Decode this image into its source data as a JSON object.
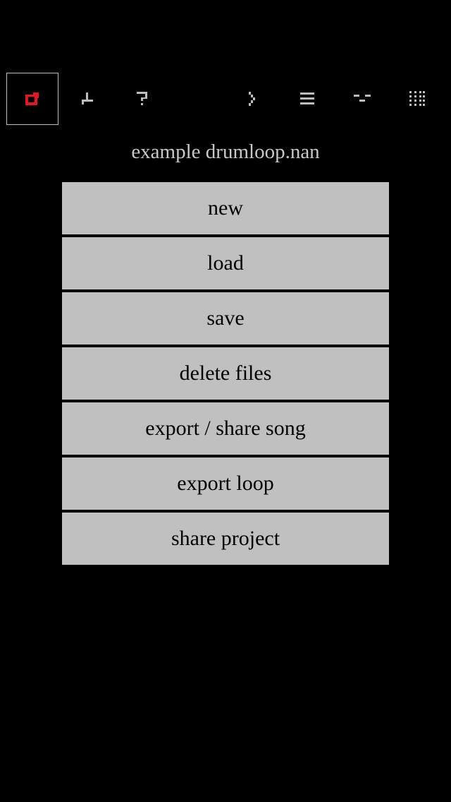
{
  "toolbar": {
    "tools": [
      {
        "icon": "file-menu-icon",
        "color": "#e8141e",
        "active": true
      },
      {
        "icon": "sample-edit-icon",
        "color": "#bdbdbd",
        "active": false
      },
      {
        "icon": "help-icon",
        "color": "#bdbdbd",
        "active": false
      },
      {
        "icon": "play-icon",
        "color": "#bdbdbd",
        "active": false
      },
      {
        "icon": "track-list-icon",
        "color": "#bdbdbd",
        "active": false
      },
      {
        "icon": "pattern-icon",
        "color": "#bdbdbd",
        "active": false
      },
      {
        "icon": "grid-icon",
        "color": "#bdbdbd",
        "active": false
      }
    ]
  },
  "project": {
    "filename": "example drumloop.nan"
  },
  "menu": {
    "new": "new",
    "load": "load",
    "save": "save",
    "delete_files": "delete files",
    "export_share_song": "export / share song",
    "export_loop": "export loop",
    "share_project": "share project"
  },
  "colors": {
    "background": "#000000",
    "button_bg": "#c0c0c0",
    "accent": "#e8141e",
    "icon": "#bdbdbd",
    "title_text": "#c8c8c8"
  }
}
